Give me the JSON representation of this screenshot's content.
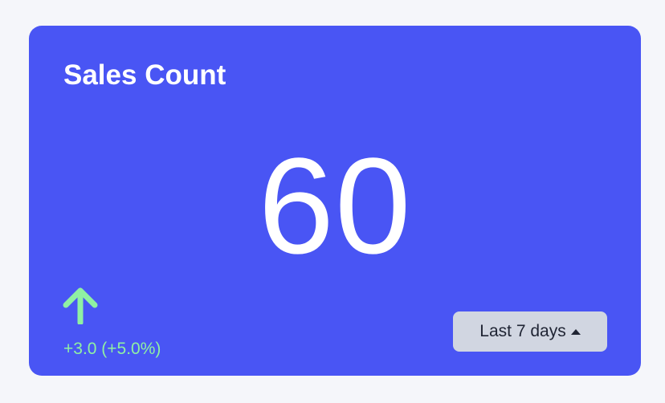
{
  "card": {
    "title": "Sales Count",
    "value": "60",
    "change_text": "+3.0 (+5.0%)",
    "trend_icon": "arrow-up-icon",
    "range_button_label": "Last 7 days",
    "range_button_icon": "caret-up-icon"
  },
  "colors": {
    "card_background": "#4955f4",
    "page_background": "#f5f6fa",
    "positive": "#8ff0a3",
    "button_background": "#d1d6e1",
    "text_primary": "#ffffff"
  }
}
